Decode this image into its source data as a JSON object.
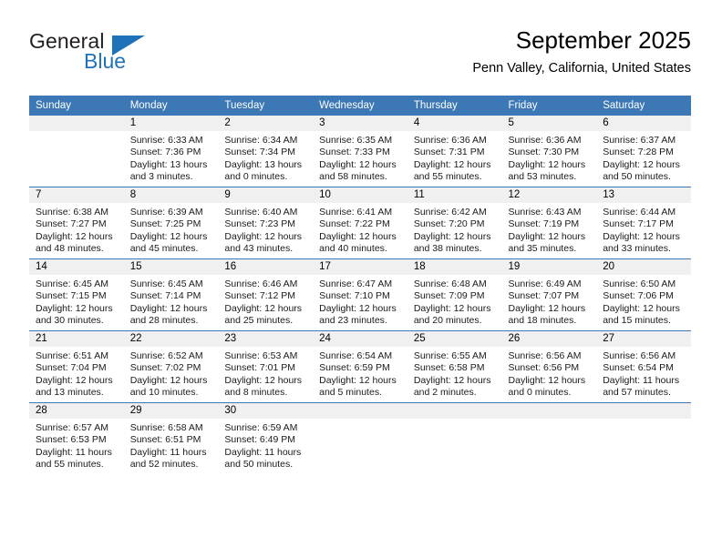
{
  "brand": {
    "name_part1": "General",
    "name_part2": "Blue",
    "logo_icon": "flag-triangle-icon",
    "accent_color": "#1f71b8"
  },
  "header": {
    "title": "September 2025",
    "subtitle": "Penn Valley, California, United States"
  },
  "calendar": {
    "header_bg_color": "#3b78b5",
    "daynum_bg_color": "#f0f0f0",
    "weekday_headers": [
      "Sunday",
      "Monday",
      "Tuesday",
      "Wednesday",
      "Thursday",
      "Friday",
      "Saturday"
    ],
    "weeks": [
      [
        {
          "day": "",
          "sunrise": "",
          "sunset": "",
          "daylight_line1": "",
          "daylight_line2": "",
          "empty": true
        },
        {
          "day": "1",
          "sunrise": "Sunrise: 6:33 AM",
          "sunset": "Sunset: 7:36 PM",
          "daylight_line1": "Daylight: 13 hours",
          "daylight_line2": "and 3 minutes."
        },
        {
          "day": "2",
          "sunrise": "Sunrise: 6:34 AM",
          "sunset": "Sunset: 7:34 PM",
          "daylight_line1": "Daylight: 13 hours",
          "daylight_line2": "and 0 minutes."
        },
        {
          "day": "3",
          "sunrise": "Sunrise: 6:35 AM",
          "sunset": "Sunset: 7:33 PM",
          "daylight_line1": "Daylight: 12 hours",
          "daylight_line2": "and 58 minutes."
        },
        {
          "day": "4",
          "sunrise": "Sunrise: 6:36 AM",
          "sunset": "Sunset: 7:31 PM",
          "daylight_line1": "Daylight: 12 hours",
          "daylight_line2": "and 55 minutes."
        },
        {
          "day": "5",
          "sunrise": "Sunrise: 6:36 AM",
          "sunset": "Sunset: 7:30 PM",
          "daylight_line1": "Daylight: 12 hours",
          "daylight_line2": "and 53 minutes."
        },
        {
          "day": "6",
          "sunrise": "Sunrise: 6:37 AM",
          "sunset": "Sunset: 7:28 PM",
          "daylight_line1": "Daylight: 12 hours",
          "daylight_line2": "and 50 minutes."
        }
      ],
      [
        {
          "day": "7",
          "sunrise": "Sunrise: 6:38 AM",
          "sunset": "Sunset: 7:27 PM",
          "daylight_line1": "Daylight: 12 hours",
          "daylight_line2": "and 48 minutes."
        },
        {
          "day": "8",
          "sunrise": "Sunrise: 6:39 AM",
          "sunset": "Sunset: 7:25 PM",
          "daylight_line1": "Daylight: 12 hours",
          "daylight_line2": "and 45 minutes."
        },
        {
          "day": "9",
          "sunrise": "Sunrise: 6:40 AM",
          "sunset": "Sunset: 7:23 PM",
          "daylight_line1": "Daylight: 12 hours",
          "daylight_line2": "and 43 minutes."
        },
        {
          "day": "10",
          "sunrise": "Sunrise: 6:41 AM",
          "sunset": "Sunset: 7:22 PM",
          "daylight_line1": "Daylight: 12 hours",
          "daylight_line2": "and 40 minutes."
        },
        {
          "day": "11",
          "sunrise": "Sunrise: 6:42 AM",
          "sunset": "Sunset: 7:20 PM",
          "daylight_line1": "Daylight: 12 hours",
          "daylight_line2": "and 38 minutes."
        },
        {
          "day": "12",
          "sunrise": "Sunrise: 6:43 AM",
          "sunset": "Sunset: 7:19 PM",
          "daylight_line1": "Daylight: 12 hours",
          "daylight_line2": "and 35 minutes."
        },
        {
          "day": "13",
          "sunrise": "Sunrise: 6:44 AM",
          "sunset": "Sunset: 7:17 PM",
          "daylight_line1": "Daylight: 12 hours",
          "daylight_line2": "and 33 minutes."
        }
      ],
      [
        {
          "day": "14",
          "sunrise": "Sunrise: 6:45 AM",
          "sunset": "Sunset: 7:15 PM",
          "daylight_line1": "Daylight: 12 hours",
          "daylight_line2": "and 30 minutes."
        },
        {
          "day": "15",
          "sunrise": "Sunrise: 6:45 AM",
          "sunset": "Sunset: 7:14 PM",
          "daylight_line1": "Daylight: 12 hours",
          "daylight_line2": "and 28 minutes."
        },
        {
          "day": "16",
          "sunrise": "Sunrise: 6:46 AM",
          "sunset": "Sunset: 7:12 PM",
          "daylight_line1": "Daylight: 12 hours",
          "daylight_line2": "and 25 minutes."
        },
        {
          "day": "17",
          "sunrise": "Sunrise: 6:47 AM",
          "sunset": "Sunset: 7:10 PM",
          "daylight_line1": "Daylight: 12 hours",
          "daylight_line2": "and 23 minutes."
        },
        {
          "day": "18",
          "sunrise": "Sunrise: 6:48 AM",
          "sunset": "Sunset: 7:09 PM",
          "daylight_line1": "Daylight: 12 hours",
          "daylight_line2": "and 20 minutes."
        },
        {
          "day": "19",
          "sunrise": "Sunrise: 6:49 AM",
          "sunset": "Sunset: 7:07 PM",
          "daylight_line1": "Daylight: 12 hours",
          "daylight_line2": "and 18 minutes."
        },
        {
          "day": "20",
          "sunrise": "Sunrise: 6:50 AM",
          "sunset": "Sunset: 7:06 PM",
          "daylight_line1": "Daylight: 12 hours",
          "daylight_line2": "and 15 minutes."
        }
      ],
      [
        {
          "day": "21",
          "sunrise": "Sunrise: 6:51 AM",
          "sunset": "Sunset: 7:04 PM",
          "daylight_line1": "Daylight: 12 hours",
          "daylight_line2": "and 13 minutes."
        },
        {
          "day": "22",
          "sunrise": "Sunrise: 6:52 AM",
          "sunset": "Sunset: 7:02 PM",
          "daylight_line1": "Daylight: 12 hours",
          "daylight_line2": "and 10 minutes."
        },
        {
          "day": "23",
          "sunrise": "Sunrise: 6:53 AM",
          "sunset": "Sunset: 7:01 PM",
          "daylight_line1": "Daylight: 12 hours",
          "daylight_line2": "and 8 minutes."
        },
        {
          "day": "24",
          "sunrise": "Sunrise: 6:54 AM",
          "sunset": "Sunset: 6:59 PM",
          "daylight_line1": "Daylight: 12 hours",
          "daylight_line2": "and 5 minutes."
        },
        {
          "day": "25",
          "sunrise": "Sunrise: 6:55 AM",
          "sunset": "Sunset: 6:58 PM",
          "daylight_line1": "Daylight: 12 hours",
          "daylight_line2": "and 2 minutes."
        },
        {
          "day": "26",
          "sunrise": "Sunrise: 6:56 AM",
          "sunset": "Sunset: 6:56 PM",
          "daylight_line1": "Daylight: 12 hours",
          "daylight_line2": "and 0 minutes."
        },
        {
          "day": "27",
          "sunrise": "Sunrise: 6:56 AM",
          "sunset": "Sunset: 6:54 PM",
          "daylight_line1": "Daylight: 11 hours",
          "daylight_line2": "and 57 minutes."
        }
      ],
      [
        {
          "day": "28",
          "sunrise": "Sunrise: 6:57 AM",
          "sunset": "Sunset: 6:53 PM",
          "daylight_line1": "Daylight: 11 hours",
          "daylight_line2": "and 55 minutes."
        },
        {
          "day": "29",
          "sunrise": "Sunrise: 6:58 AM",
          "sunset": "Sunset: 6:51 PM",
          "daylight_line1": "Daylight: 11 hours",
          "daylight_line2": "and 52 minutes."
        },
        {
          "day": "30",
          "sunrise": "Sunrise: 6:59 AM",
          "sunset": "Sunset: 6:49 PM",
          "daylight_line1": "Daylight: 11 hours",
          "daylight_line2": "and 50 minutes."
        },
        {
          "day": "",
          "sunrise": "",
          "sunset": "",
          "daylight_line1": "",
          "daylight_line2": "",
          "empty": true
        },
        {
          "day": "",
          "sunrise": "",
          "sunset": "",
          "daylight_line1": "",
          "daylight_line2": "",
          "empty": true
        },
        {
          "day": "",
          "sunrise": "",
          "sunset": "",
          "daylight_line1": "",
          "daylight_line2": "",
          "empty": true
        },
        {
          "day": "",
          "sunrise": "",
          "sunset": "",
          "daylight_line1": "",
          "daylight_line2": "",
          "empty": true
        }
      ]
    ]
  }
}
